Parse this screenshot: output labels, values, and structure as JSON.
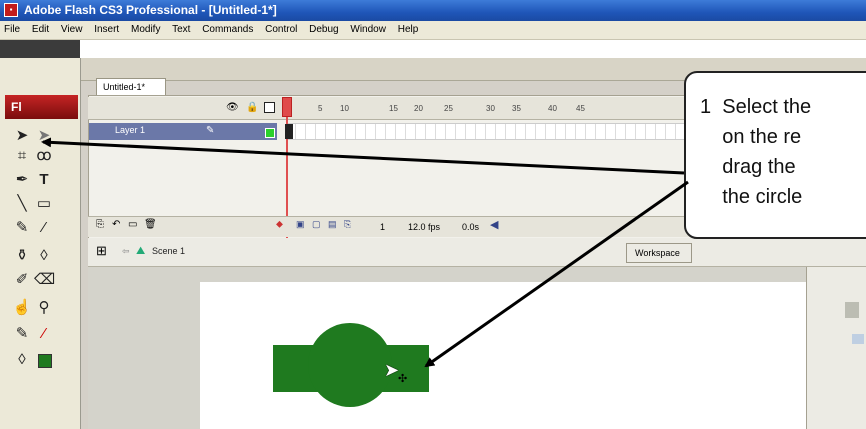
{
  "window": {
    "title": "Adobe Flash CS3 Professional - [Untitled-1*]"
  },
  "menu": [
    "File",
    "Edit",
    "View",
    "Insert",
    "Modify",
    "Text",
    "Commands",
    "Control",
    "Debug",
    "Window",
    "Help"
  ],
  "tools_panel": {
    "logo": "Fl"
  },
  "document": {
    "tab_label": "Untitled-1*"
  },
  "timeline": {
    "frame_numbers": [
      "5",
      "10",
      "15",
      "20",
      "25",
      "30",
      "35",
      "40",
      "45"
    ],
    "layer_name": "Layer 1",
    "current_frame": "1",
    "fps": "12.0 fps",
    "time": "0.0s"
  },
  "editbar": {
    "scene": "Scene 1",
    "workspace": "Workspace"
  },
  "callout": {
    "text": "1  Select the\n    on the re\n    drag the\n    the circle"
  },
  "colors": {
    "shape_fill": "#1f7a1f",
    "title_bar": "#1f56b8",
    "playhead": "#e05050"
  }
}
